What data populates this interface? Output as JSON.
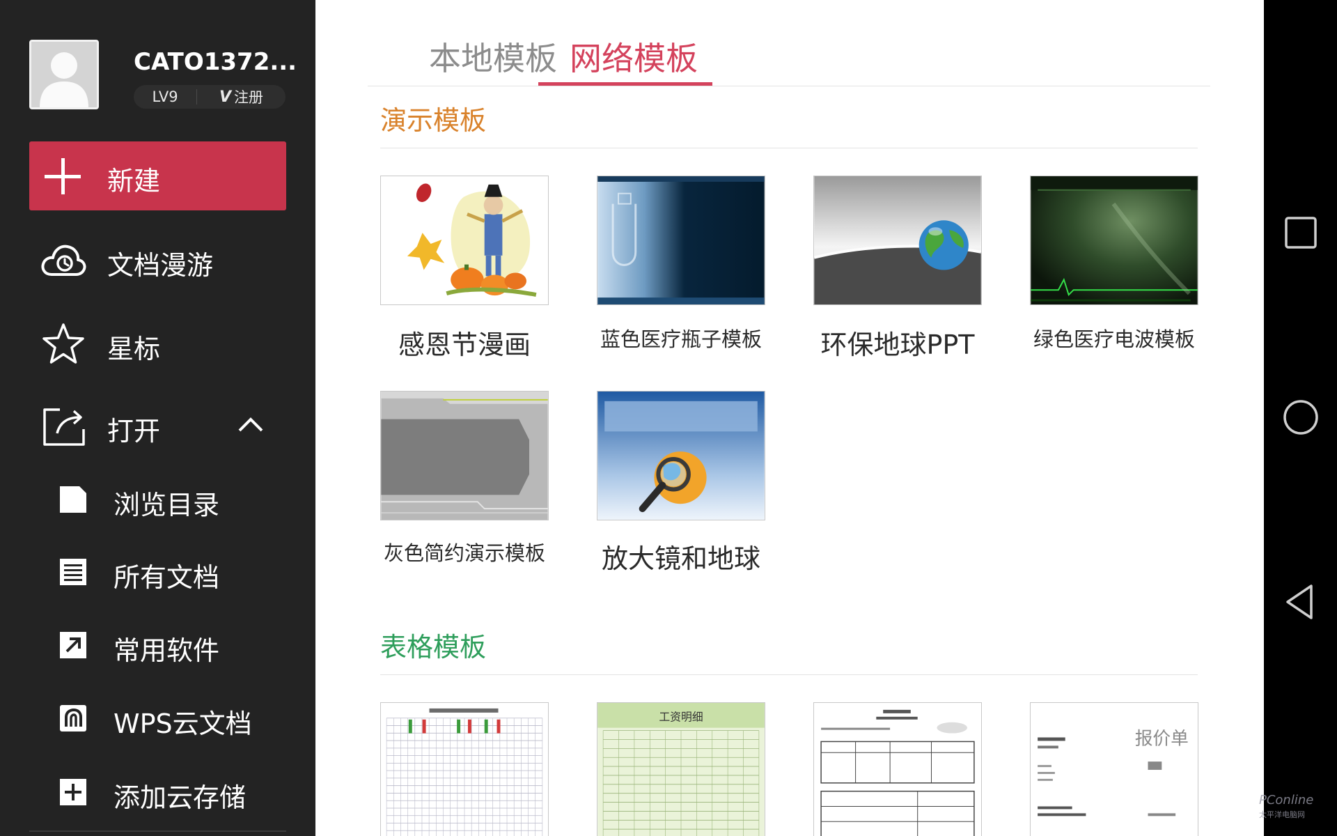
{
  "user": {
    "name": "CATO1372...",
    "level": "LV9",
    "register_label": "注册",
    "register_badge": "V"
  },
  "sidebar": {
    "new_label": "新建",
    "items": [
      {
        "label": "文档漫游",
        "icon": "cloud-icon"
      },
      {
        "label": "星标",
        "icon": "star-icon"
      },
      {
        "label": "打开",
        "icon": "open-folder-icon",
        "expanded": true
      }
    ],
    "sub_items": [
      {
        "label": "浏览目录",
        "icon": "file-icon"
      },
      {
        "label": "所有文档",
        "icon": "document-list-icon"
      },
      {
        "label": "常用软件",
        "icon": "arrow-up-right-icon"
      },
      {
        "label": "WPS云文档",
        "icon": "wps-cloud-icon"
      },
      {
        "label": "添加云存储",
        "icon": "add-square-icon"
      }
    ]
  },
  "tabs": [
    {
      "label": "本地模板",
      "active": false
    },
    {
      "label": "网络模板",
      "active": true
    }
  ],
  "sections": {
    "presentation": {
      "title": "演示模板",
      "color": "#d9822b",
      "templates": [
        {
          "label": "感恩节漫画"
        },
        {
          "label": "蓝色医疗瓶子模板"
        },
        {
          "label": "环保地球PPT"
        },
        {
          "label": "绿色医疗电波模板"
        },
        {
          "label": "灰色简约演示模板"
        },
        {
          "label": "放大镜和地球"
        }
      ]
    },
    "spreadsheet": {
      "title": "表格模板",
      "color": "#2e9e5b",
      "thumb_texts": {
        "payroll": "工资明细",
        "quote": "报价单"
      }
    }
  },
  "watermark": {
    "brand": "PConline",
    "sub": "太平洋电脑网"
  },
  "colors": {
    "accent": "#d4425c",
    "new_button": "#c8344c",
    "sidebar_bg": "#232323"
  }
}
